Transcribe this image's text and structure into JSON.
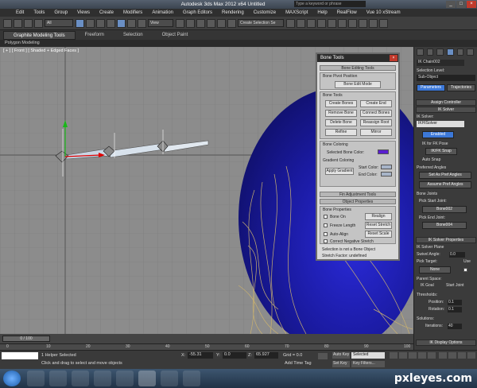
{
  "window": {
    "title": "Autodesk 3ds Max  2012 x64     Untitled",
    "search_placeholder": "Type a keyword or phrase"
  },
  "menu": [
    "Edit",
    "Tools",
    "Group",
    "Views",
    "Create",
    "Modifiers",
    "Animation",
    "Graph Editors",
    "Rendering",
    "Customize",
    "MAXScript",
    "Help",
    "RealFlow",
    "Vue 10 xStream"
  ],
  "toolbar": {
    "select_filter": "All",
    "view_dropdown": "View",
    "selection_set": "Create Selection Se"
  },
  "ribbon": {
    "tabs": [
      "Graphite Modeling Tools",
      "Freeform",
      "Selection",
      "Object Paint"
    ],
    "sub": "Polygon Modeling"
  },
  "viewport": {
    "label": "[ + ] [ Front ] [ Shaded + Edged Faces ]"
  },
  "bone_tools": {
    "title": "Bone Tools",
    "editing_header": "Bone Editing Tools",
    "pivot_label": "Bone Pivot Position",
    "edit_mode": "Bone Edit Mode",
    "tools_label": "Bone Tools",
    "create_bones": "Create Bones",
    "create_end": "Create End",
    "remove_bone": "Remove Bone",
    "connect_bones": "Connect Bones",
    "delete_bone": "Delete Bone",
    "reassign_root": "Reassign Root",
    "refine": "Refine",
    "mirror": "Mirror",
    "coloring_label": "Bone Coloring",
    "selected_color": "Selected Bone Color:",
    "gradient_label": "Gradient Coloring",
    "apply_gradient": "Apply Gradient",
    "start_color": "Start Color:",
    "end_color": "End Color:",
    "fin_header": "Fin Adjustment Tools",
    "props_header": "Object Properties",
    "bone_props_label": "Bone Properties",
    "bone_on": "Bone On",
    "realign": "Realign",
    "freeze_length": "Freeze Length",
    "reset_stretch": "Reset Stretch",
    "auto_align": "Auto-Align",
    "reset_scale": "Reset Scale",
    "correct_neg": "Correct Negative Stretch",
    "info1": "Selection is not a Bone Object",
    "info2": "Stretch Factor: undefined",
    "colors": {
      "selected": "#5a1fd0",
      "start": "#a7b4c8",
      "end": "#a7b4c8"
    }
  },
  "command_panel": {
    "object_name": "IK Chain002",
    "selection_level": "Selection Level:",
    "sub_object": "Sub-Object",
    "tabs": [
      "Parameters",
      "Trajectories"
    ],
    "assign_controller": "Assign Controller",
    "ik_solver": "IK Solver",
    "ik_solver_label": "IK Solver:",
    "solver_value": "IKHISolver",
    "enabled": "Enabled",
    "ik_fk_snap": "IK for FK Pose",
    "ikfk_snap_btn": "IK/FK Snap",
    "auto_snap": "Auto Snap",
    "preferred_angles": "Preferred Angles",
    "set_pref": "Set As Pref Angles",
    "assume_pref": "Assume Pref Angles",
    "bone_joints": "Bone Joints",
    "pick_start": "Pick Start Joint:",
    "start_joint": "Bone002",
    "pick_end": "Pick End Joint:",
    "end_joint": "Bone004",
    "ik_props": "IK Solver Properties",
    "ik_plane": "IK Solver Plane",
    "swivel": "Swivel Angle:",
    "swivel_val": "0.0",
    "pick_target": "Pick Target:",
    "use": "Use",
    "none": "None",
    "parent_space": "Parent Space:",
    "ik_goal": "IK Goal",
    "start_joint_radio": "Start Joint",
    "thresholds": "Thresholds:",
    "position": "Position:",
    "position_val": "0.1",
    "rotation": "Rotation:",
    "rotation_val": "0.1",
    "solutions": "Solutions:",
    "iterations": "Iterations:",
    "iterations_val": "40",
    "ik_display": "IK Display Options"
  },
  "timeline": {
    "frame": "0 / 100",
    "ticks": [
      "0",
      "10",
      "20",
      "30",
      "40",
      "50",
      "60",
      "70",
      "80",
      "90",
      "100"
    ]
  },
  "status": {
    "selected": "1 Helper Selected",
    "prompt": "Click and drag to select and move objects",
    "x": "-55.31",
    "y": "0.0",
    "z": "65.927",
    "grid": "Grid = 0.0",
    "auto_key": "Auto Key",
    "set_key": "Set Key",
    "selected_dd": "Selected",
    "key_filters": "Key Filters...",
    "add_time_tag": "Add Time Tag"
  },
  "watermark": "pxleyes.com"
}
